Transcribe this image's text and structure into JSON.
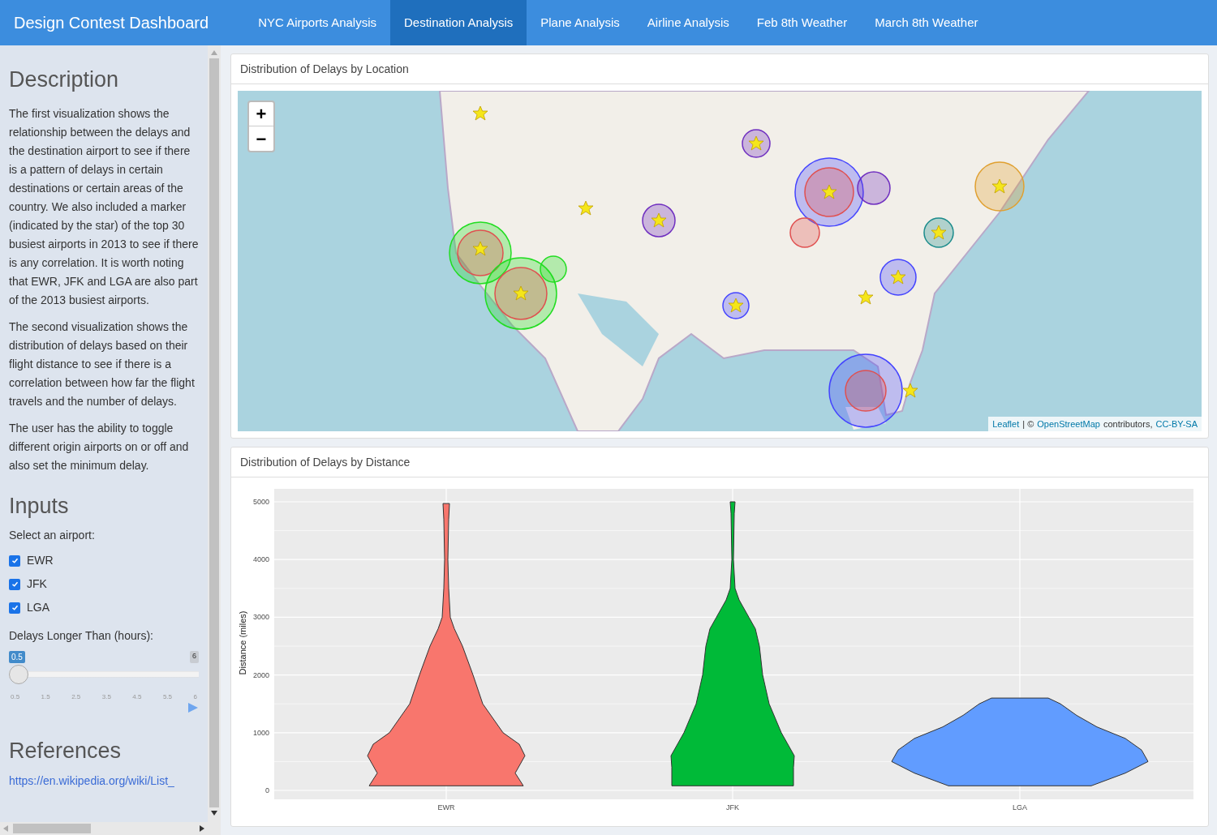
{
  "navbar": {
    "brand": "Design Contest Dashboard",
    "tabs": [
      {
        "label": "NYC Airports Analysis",
        "selected": false
      },
      {
        "label": "Destination Analysis",
        "selected": true
      },
      {
        "label": "Plane Analysis",
        "selected": false
      },
      {
        "label": "Airline Analysis",
        "selected": false
      },
      {
        "label": "Feb 8th Weather",
        "selected": false
      },
      {
        "label": "March 8th Weather",
        "selected": false
      }
    ]
  },
  "sidebar": {
    "description_title": "Description",
    "paragraphs": [
      "The first visualization shows the relationship between the delays and the destination airport to see if there is a pattern of delays in certain destinations or certain areas of the country. We also included a marker (indicated by the star) of the top 30 busiest airports in 2013 to see if there is any correlation. It is worth noting that EWR, JFK and LGA are also part of the 2013 busiest airports.",
      "The second visualization shows the distribution of delays based on their flight distance to see if there is a correlation between how far the flight travels and the number of delays.",
      "The user has the ability to toggle different origin airports on or off and also set the minimum delay."
    ],
    "inputs_title": "Inputs",
    "airport_label": "Select an airport:",
    "airports": [
      {
        "label": "EWR",
        "checked": true
      },
      {
        "label": "JFK",
        "checked": true
      },
      {
        "label": "LGA",
        "checked": true
      }
    ],
    "slider": {
      "label": "Delays Longer Than (hours):",
      "value": "0.5",
      "max": "6",
      "level": 0,
      "ticks": [
        "0.5",
        "1.5",
        "2.5",
        "3.5",
        "4.5",
        "5.5",
        "6"
      ]
    },
    "references_title": "References",
    "reference_link": "https://en.wikipedia.org/wiki/List_"
  },
  "map_panel": {
    "title": "Distribution of Delays by Location",
    "zoom_in": "+",
    "zoom_out": "−",
    "attribution": {
      "link1": "Leaflet",
      "sep": "| ©",
      "link2": "OpenStreetMap",
      "text": "contributors,",
      "link3": "CC-BY-SA"
    }
  },
  "chart_panel": {
    "title": "Distribution of Delays by Distance",
    "ylabel": "Distance (miles)",
    "yticks": [
      "5000",
      "4000",
      "3000",
      "2000",
      "1000",
      "0"
    ],
    "groups": [
      {
        "label": "EWR",
        "color": "#f8766d"
      },
      {
        "label": "JFK",
        "color": "#00ba38"
      },
      {
        "label": "LGA",
        "color": "#619cff"
      }
    ]
  }
}
